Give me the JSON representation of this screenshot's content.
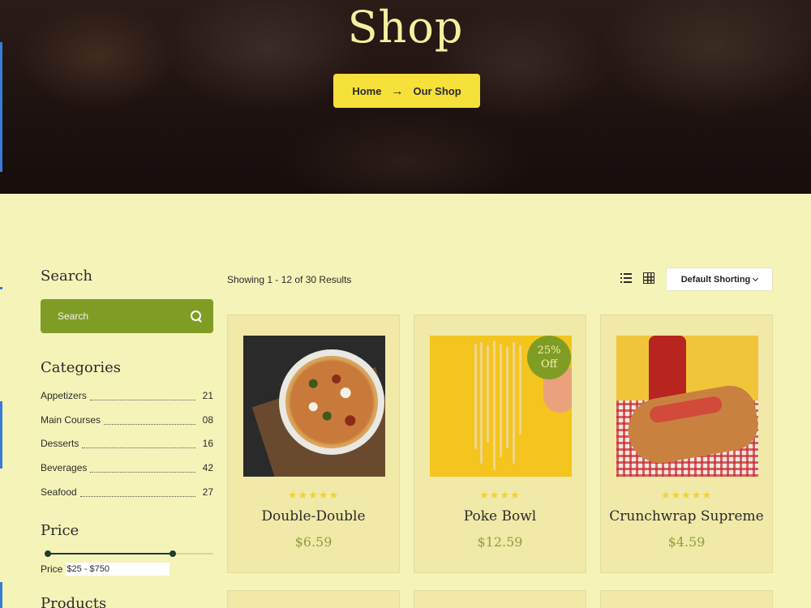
{
  "hero": {
    "title": "Shop",
    "breadcrumb": {
      "home": "Home",
      "current": "Our Shop"
    }
  },
  "sidebar": {
    "search": {
      "title": "Search",
      "placeholder": "Search"
    },
    "categories": {
      "title": "Categories",
      "items": [
        {
          "label": "Appetizers",
          "count": "21"
        },
        {
          "label": "Main Courses",
          "count": "08"
        },
        {
          "label": "Desserts",
          "count": "16"
        },
        {
          "label": "Beverages",
          "count": "42"
        },
        {
          "label": "Seafood",
          "count": "27"
        }
      ]
    },
    "price": {
      "title": "Price",
      "label": "Price",
      "value": "$25 - $750",
      "range_min_pct": 0,
      "range_max_pct": 75
    },
    "products_title": "Products"
  },
  "toolbar": {
    "results": "Showing 1 - 12 of 30 Results",
    "sort_label": "Default Shorting"
  },
  "products": [
    {
      "name": "Double-Double",
      "price": "$6.59",
      "stars": "★★★★★",
      "rating": 5
    },
    {
      "name": "Poke Bowl",
      "price": "$12.59",
      "stars": "★★★★",
      "rating": 4,
      "badge_line1": "25%",
      "badge_line2": "Off"
    },
    {
      "name": "Crunchwrap Supreme",
      "price": "$4.59",
      "stars": "★★★★★",
      "rating": 5
    }
  ],
  "colors": {
    "background": "#f5f4b8",
    "accent_green": "#7f9d24",
    "accent_yellow": "#f6e03a",
    "price_green": "#8aa33a",
    "star": "#efd23a"
  }
}
